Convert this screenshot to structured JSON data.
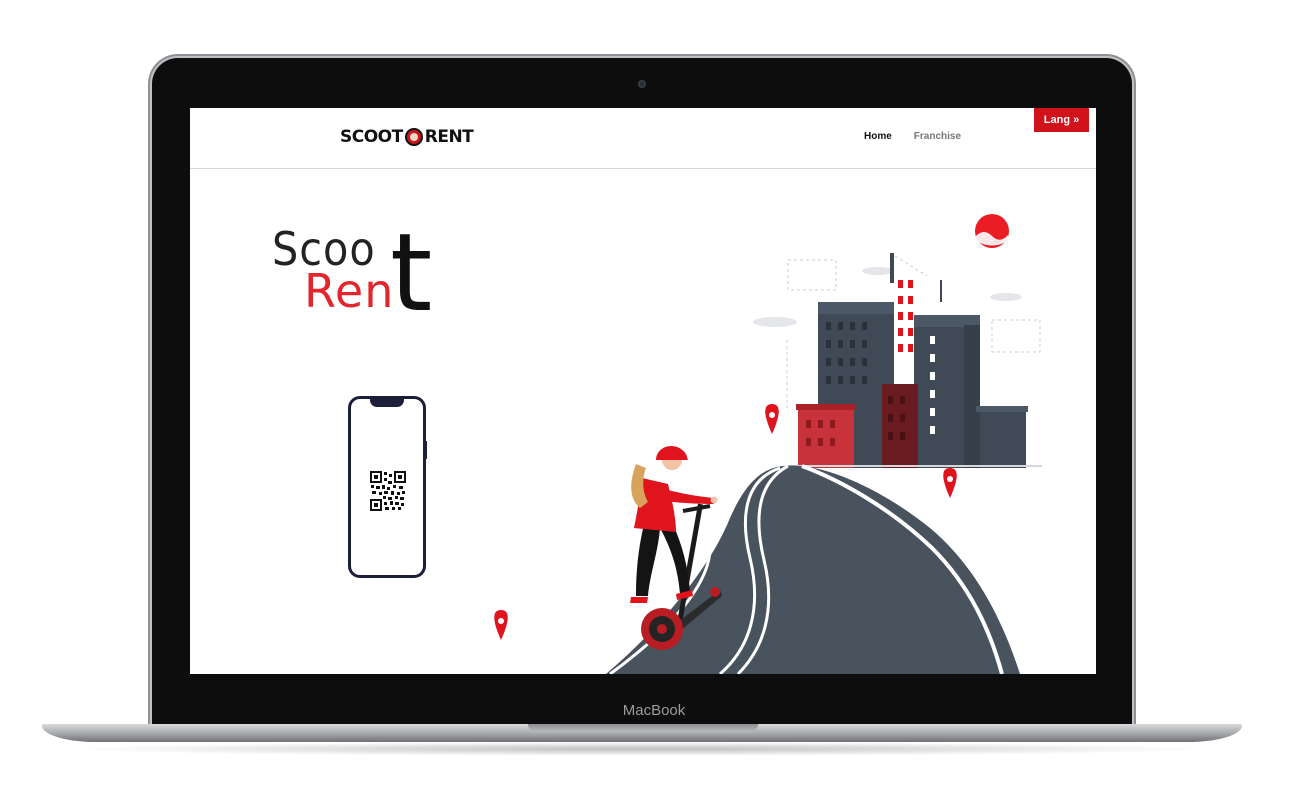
{
  "device": {
    "brand_label": "MacBook"
  },
  "navbar": {
    "logo": {
      "left": "SCOOT",
      "right": "RENT"
    },
    "links": [
      {
        "label": "Home",
        "active": true
      },
      {
        "label": "Franchise",
        "active": false
      }
    ],
    "lang_button": "Lang »"
  },
  "hero": {
    "title_line1": "Scoo",
    "title_line2": "Ren",
    "title_shared_letter": "t"
  },
  "icons": {
    "qr": "qr-code-icon",
    "location_pin": "location-pin-icon",
    "sun": "sun-icon"
  },
  "colors": {
    "accent": "#e0141d",
    "dark": "#111111",
    "buildings": "#3f4a56",
    "road": "#4a5560",
    "phone_frame": "#1c1f3a"
  }
}
